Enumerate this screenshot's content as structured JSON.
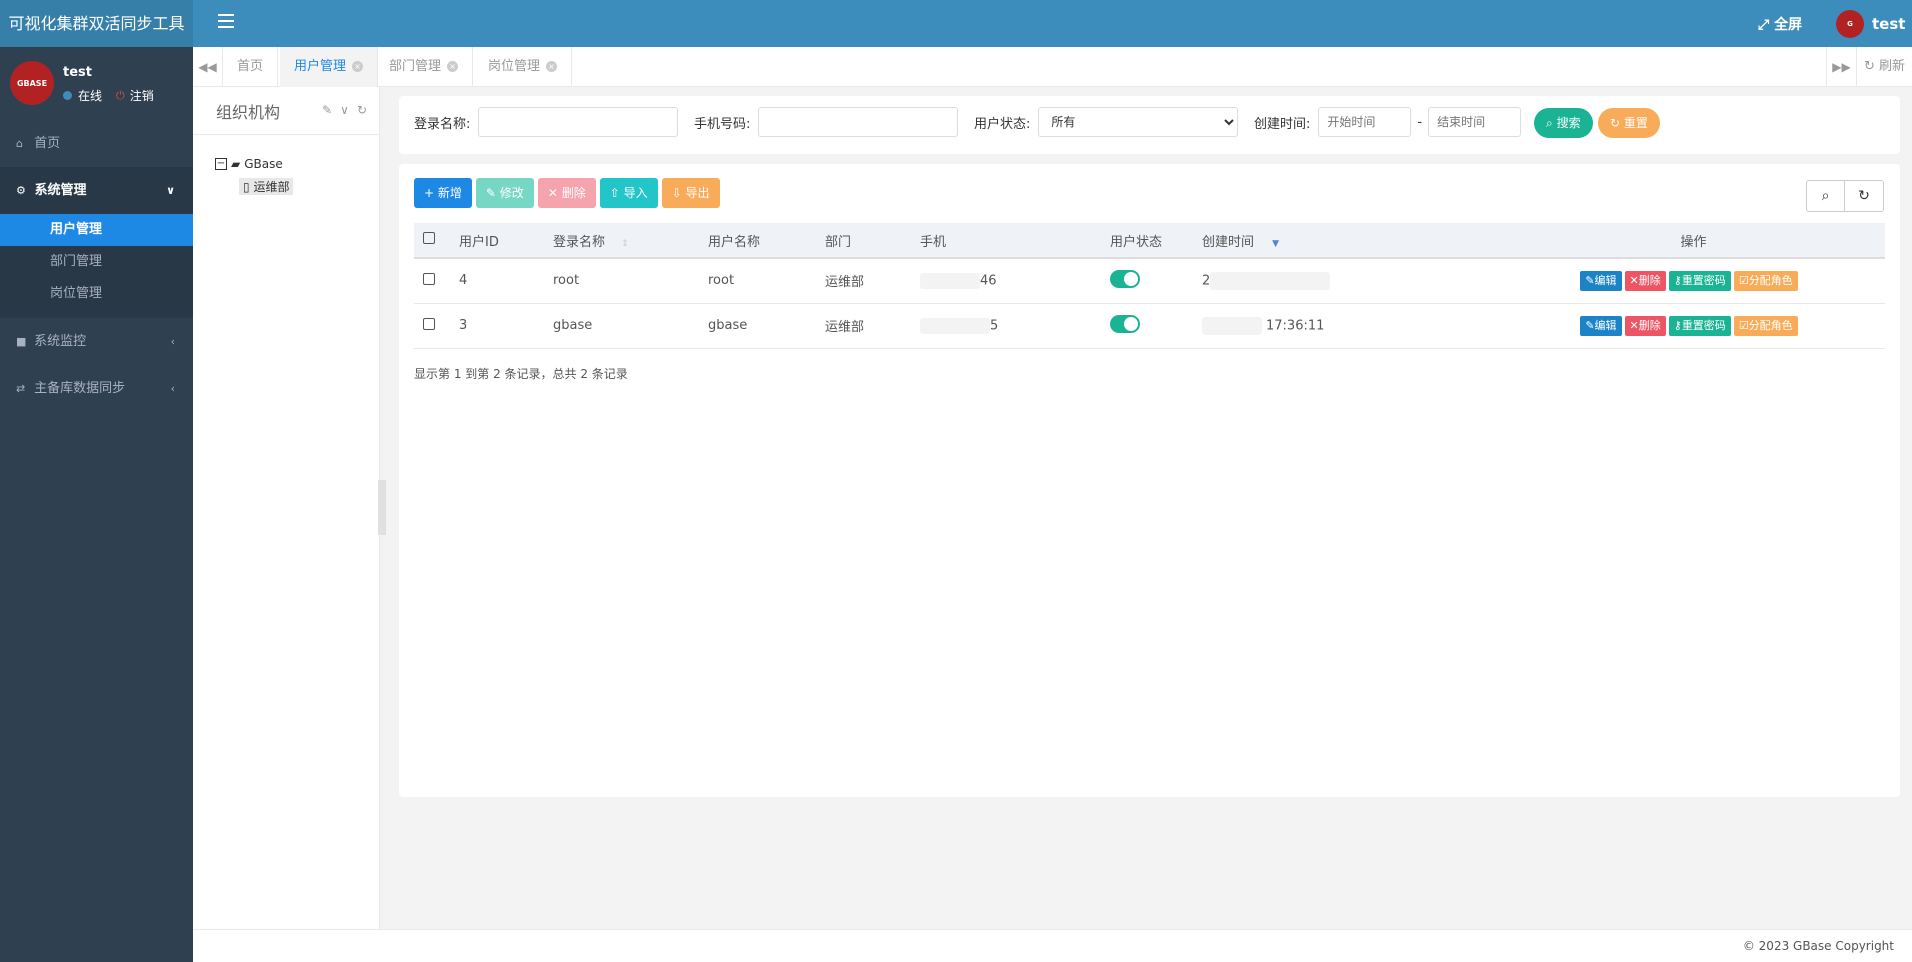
{
  "app": {
    "title": "可视化集群双活同步工具",
    "fullscreen_label": "全屏",
    "current_user": "test"
  },
  "user_panel": {
    "name": "test",
    "status": "在线",
    "logout": "注销",
    "avatar_text": "GBASE"
  },
  "sidebar": {
    "items": [
      {
        "label": "首页",
        "icon": "home-icon"
      },
      {
        "label": "系统管理",
        "icon": "gear-icon"
      },
      {
        "label": "系统监控",
        "icon": "video-icon"
      },
      {
        "label": "主备库数据同步",
        "icon": "sync-icon"
      }
    ],
    "sub_items": [
      {
        "label": "用户管理"
      },
      {
        "label": "部门管理"
      },
      {
        "label": "岗位管理"
      }
    ]
  },
  "tabs": {
    "items": [
      {
        "label": "首页"
      },
      {
        "label": "用户管理"
      },
      {
        "label": "部门管理"
      },
      {
        "label": "岗位管理"
      }
    ],
    "refresh_label": "刷新"
  },
  "org_panel": {
    "title": "组织机构",
    "root": "GBase",
    "child": "运维部"
  },
  "search": {
    "login_name_label": "登录名称:",
    "phone_label": "手机号码:",
    "status_label": "用户状态:",
    "status_value": "所有",
    "created_label": "创建时间:",
    "start_placeholder": "开始时间",
    "end_placeholder": "结束时间",
    "dash": "-",
    "search_btn": "搜索",
    "reset_btn": "重置"
  },
  "toolbar": {
    "add": "新增",
    "edit": "修改",
    "delete": "删除",
    "import": "导入",
    "export": "导出"
  },
  "table": {
    "headers": [
      "用户ID",
      "登录名称",
      "用户名称",
      "部门",
      "手机",
      "用户状态",
      "创建时间",
      "操作"
    ],
    "rows": [
      {
        "id": "4",
        "login": "root",
        "name": "root",
        "dept": "运维部",
        "phone": "46",
        "created": "2"
      },
      {
        "id": "3",
        "login": "gbase",
        "name": "gbase",
        "dept": "运维部",
        "phone": "5",
        "created": "17:36:11"
      }
    ],
    "actions": {
      "edit": "编辑",
      "delete": "删除",
      "reset_pwd": "重置密码",
      "assign_role": "分配角色"
    },
    "pager": "显示第 1 到第 2 条记录，总共 2 条记录"
  },
  "footer": {
    "copyright": "© 2023 GBase Copyright"
  },
  "colors": {
    "topbar": "#3c8dbc",
    "sidebar": "#2f4050",
    "primary": "#1e88e5",
    "success": "#1ab394",
    "danger": "#ed5565",
    "warning": "#f8ac59"
  }
}
